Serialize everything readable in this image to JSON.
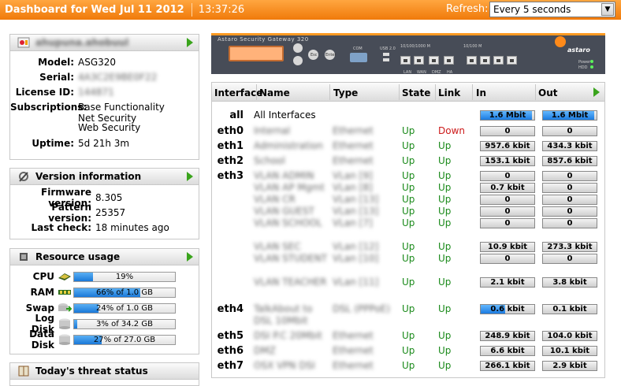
{
  "header": {
    "title": "Dashboard for Wed Jul 11 2012",
    "time": "13:37:26",
    "refresh_label": "Refresh:",
    "refresh_value": "Every 5 seconds"
  },
  "system_panel": {
    "title": "ahupuna.ahobuul",
    "fields": [
      {
        "label": "Model:",
        "value": "ASG320"
      },
      {
        "label": "Serial:",
        "value": "4A3C2E9BE0F22"
      },
      {
        "label": "License ID:",
        "value": "144871"
      },
      {
        "label": "Subscriptions:",
        "value": "Base Functionality",
        "extra": [
          "Net Security",
          "Web Security"
        ]
      },
      {
        "label": "Uptime:",
        "value": "5d 21h 3m"
      }
    ]
  },
  "version_panel": {
    "title": "Version information",
    "fields": [
      {
        "label": "Firmware version:",
        "value": "8.305"
      },
      {
        "label": "Pattern version:",
        "value": "25357"
      },
      {
        "label": "Last check:",
        "value": "18 minutes ago"
      }
    ]
  },
  "resource_panel": {
    "title": "Resource usage",
    "items": [
      {
        "label": "CPU",
        "text": "19%",
        "pct": 19
      },
      {
        "label": "RAM",
        "text": "66% of 1.0 GB",
        "pct": 66
      },
      {
        "label": "Swap",
        "text": "24% of 1.0 GB",
        "pct": 24
      },
      {
        "label": "Log Disk",
        "text": "3% of 34.2 GB",
        "pct": 3
      },
      {
        "label": "Data Disk",
        "text": "27% of 27.0 GB",
        "pct": 27
      }
    ]
  },
  "threat_panel": {
    "title": "Today's threat status"
  },
  "appliance": {
    "title": "Astaro Security Gateway 320",
    "brand": "astaro",
    "labels": {
      "com": "COM",
      "usb": "USB 2.0",
      "group1": "10/100/1000 M",
      "group2": "10/100 M",
      "esc": "Esc",
      "enter": "Enter",
      "power": "Power",
      "hdd": "HDD",
      "lan": "LAN",
      "wan": "WAN",
      "dmz": "DMZ",
      "ha": "HA"
    }
  },
  "interfaces": {
    "columns": [
      "Interface",
      "Name",
      "Type",
      "State",
      "Link",
      "In",
      "Out"
    ],
    "rows": [
      {
        "iface": "all",
        "name": "All Interfaces",
        "type": "",
        "state": "",
        "link": "",
        "in": "1.6 Mbit",
        "out": "1.6 Mbit",
        "in_fill": 0.95,
        "out_fill": 0.95,
        "clear": true
      },
      {
        "iface": "eth0",
        "name": "Internal",
        "type": "Ethernet",
        "state": "Up",
        "link": "Down",
        "in": "0",
        "out": "0"
      },
      {
        "iface": "eth1",
        "name": "Administration",
        "type": "Ethernet",
        "state": "Up",
        "link": "Up",
        "in": "957.6 kbit",
        "out": "434.3 kbit"
      },
      {
        "iface": "eth2",
        "name": "School",
        "type": "Ethernet",
        "state": "Up",
        "link": "Up",
        "in": "153.1 kbit",
        "out": "857.6 kbit"
      },
      {
        "iface": "eth3",
        "name": "VLAN ADMIN",
        "type": "VLan [9]",
        "state": "Up",
        "link": "Up",
        "in": "0",
        "out": "0"
      },
      {
        "iface": "",
        "name": "VLAN AP Mgmt",
        "type": "VLan [8]",
        "state": "Up",
        "link": "Up",
        "in": "0.7 kbit",
        "out": "0"
      },
      {
        "iface": "",
        "name": "VLAN CR",
        "type": "VLan [13]",
        "state": "Up",
        "link": "Up",
        "in": "0",
        "out": "0"
      },
      {
        "iface": "",
        "name": "VLAN GUEST",
        "type": "VLan [13]",
        "state": "Up",
        "link": "Up",
        "in": "0",
        "out": "0"
      },
      {
        "iface": "",
        "name": "VLAN SCHOOL",
        "type": "VLan [7]",
        "state": "Up",
        "link": "Up",
        "in": "0",
        "out": "0"
      },
      {
        "iface": "",
        "name": "VLAN SEC",
        "type": "VLan [12]",
        "state": "Up",
        "link": "Up",
        "in": "10.9 kbit",
        "out": "273.3 kbit"
      },
      {
        "iface": "",
        "name": "VLAN STUDENT",
        "type": "VLan [10]",
        "state": "Up",
        "link": "Up",
        "in": "0",
        "out": "0"
      },
      {
        "iface": "",
        "name": "VLAN TEACHER",
        "type": "VLan [11]",
        "state": "Up",
        "link": "Up",
        "in": "2.1 kbit",
        "out": "3.8 kbit"
      },
      {
        "iface": "eth4",
        "name": "TalkAbout to DSL 10Mbit",
        "type": "DSL (PPPoE)",
        "state": "Up",
        "link": "Up",
        "in": "0.6 kbit",
        "out": "0.1 kbit",
        "in_fill": 0.45
      },
      {
        "iface": "eth5",
        "name": "DSI P.C 20Mbit",
        "type": "Ethernet",
        "state": "Up",
        "link": "Up",
        "in": "248.9 kbit",
        "out": "104.0 kbit"
      },
      {
        "iface": "eth6",
        "name": "DMZ",
        "type": "Ethernet",
        "state": "Up",
        "link": "Up",
        "in": "6.6 kbit",
        "out": "10.1 kbit"
      },
      {
        "iface": "eth7",
        "name": "OSX VPN DSI",
        "type": "Ethernet",
        "state": "Up",
        "link": "Up",
        "in": "266.1 kbit",
        "out": "2.9 kbit"
      }
    ]
  }
}
